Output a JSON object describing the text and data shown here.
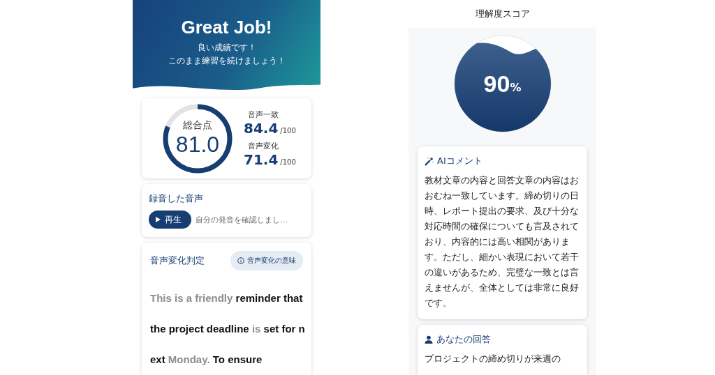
{
  "result_screen": {
    "header": {
      "title": "Great Job!",
      "lines": [
        "良い成績です！",
        "このまま練習を続けましょう！"
      ]
    },
    "total_score": {
      "label": "総合点",
      "value": "81.0"
    },
    "sub_scores": [
      {
        "label": "音声一致",
        "value": "84.4",
        "max": "/100"
      },
      {
        "label": "音声変化",
        "value": "71.4",
        "max": "/100"
      }
    ],
    "recording": {
      "title": "録音した音声",
      "play_button": "再生",
      "hint": "自分の発音を確認しまし…"
    },
    "voice_change": {
      "title": "音声変化判定",
      "info_button": "音声変化の意味",
      "segments": [
        {
          "text": "This is a friendly",
          "reduced": true
        },
        {
          "text": "reminder that the project deadline",
          "reduced": false
        },
        {
          "text": "is",
          "reduced": true
        },
        {
          "text": "set for next",
          "reduced": false
        },
        {
          "text": "Monday.",
          "reduced": true
        },
        {
          "text": "To ensure",
          "reduced": false
        }
      ]
    }
  },
  "comprehension_screen": {
    "title": "理解度スコア",
    "score": {
      "value": "90",
      "unit": "%"
    },
    "ai_comment": {
      "title": "AIコメント",
      "body": "教材文章の内容と回答文章の内容はおおむね一致しています。締め切りの日時、レポート提出の要求、及び十分な対応時間の確保についても言及されており、内容的には高い相関があります。ただし、細かい表現において若干の違いがあるため、完璧な一致とは言えませんが、全体としては非常に良好です。"
    },
    "your_answer": {
      "title": "あなたの回答",
      "body": "プロジェクトの締め切りが来週の"
    }
  }
}
